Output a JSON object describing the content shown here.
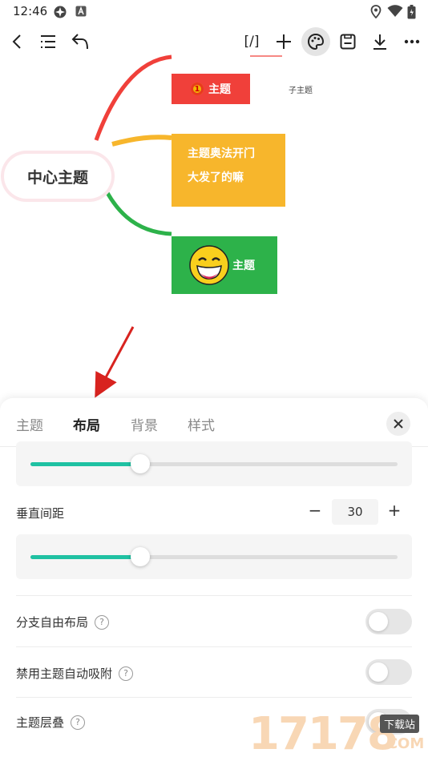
{
  "status_bar": {
    "time": "12:46"
  },
  "toolbar": {
    "back_icon": "chevron-left-icon",
    "outline_icon": "outline-list-icon",
    "undo_icon": "undo-icon",
    "formula_label": "[/]",
    "add_icon": "plus-icon",
    "style_icon": "palette-icon",
    "save_icon": "save-icon",
    "download_icon": "download-icon",
    "more_icon": "more-icon"
  },
  "mindmap": {
    "center_topic": "中心主题",
    "topics": [
      {
        "label": "主题",
        "color": "#f0403a",
        "badge": "1"
      },
      {
        "line1": "主题奥法开门",
        "line2": "大发了的嘛",
        "color": "#f7b62c"
      },
      {
        "label": "主题",
        "color": "#2db24a",
        "image": "laughing-emoji"
      }
    ],
    "subtopic": "子主题"
  },
  "sheet": {
    "tabs": [
      {
        "label": "主题",
        "active": false
      },
      {
        "label": "布局",
        "active": true
      },
      {
        "label": "背景",
        "active": false
      },
      {
        "label": "样式",
        "active": false
      }
    ],
    "slider1": {
      "value": 0.3
    },
    "vertical_spacing": {
      "label": "垂直间距",
      "minus": "−",
      "value": "30",
      "plus": "+",
      "slider": 0.3
    },
    "branch_free_layout": {
      "label": "分支自由布局",
      "help": "?",
      "on": false
    },
    "disable_snap": {
      "label": "禁用主题自动吸附",
      "help": "?",
      "on": false
    },
    "topic_overlap": {
      "label": "主题层叠",
      "help": "?",
      "on": false
    }
  },
  "accent_color": "#1fc1a2",
  "watermark": {
    "number": "17178",
    "tag": "下载站",
    "suffix": ".COM"
  }
}
